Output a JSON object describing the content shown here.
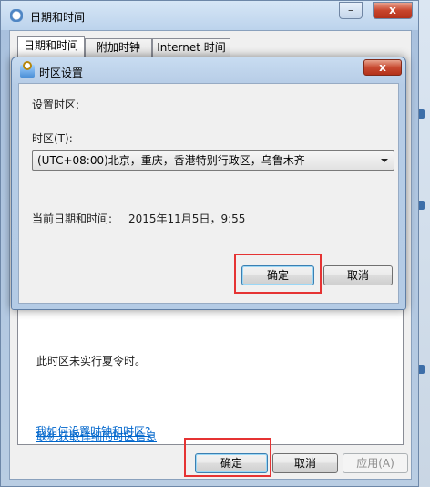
{
  "window": {
    "title": "日期和时间",
    "minimize": "–",
    "close": "x"
  },
  "tabs": [
    {
      "label": "日期和时间"
    },
    {
      "label": "附加时钟"
    },
    {
      "label": "Internet 时间"
    }
  ],
  "main": {
    "dst_text": "此时区未实行夏令时。",
    "link_online": "联机获取详细的时区信息",
    "link_howto": "我如何设置时钟和时区?",
    "ok": "确定",
    "cancel": "取消",
    "apply": "应用(A)"
  },
  "dialog": {
    "title": "时区设置",
    "close": "x",
    "heading": "设置时区:",
    "tz_label": "时区(T):",
    "tz_value": "(UTC+08:00)北京，重庆，香港特别行政区，乌鲁木齐",
    "current_label": "当前日期和时间:",
    "current_value": "2015年11月5日，9:55",
    "ok": "确定",
    "cancel": "取消"
  },
  "colors": {
    "highlight": "#e53333",
    "link": "#0066cc"
  }
}
